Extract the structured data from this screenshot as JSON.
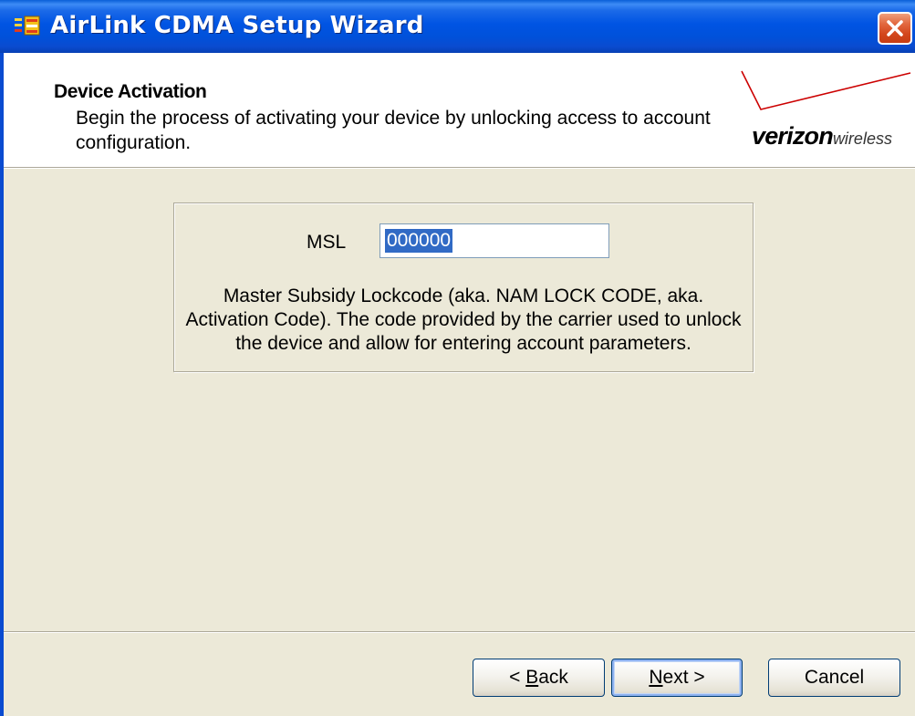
{
  "window": {
    "title": "AirLink CDMA Setup Wizard",
    "app_icon": "wizard-app-icon",
    "close_icon": "close-icon"
  },
  "header": {
    "title": "Device Activation",
    "description": "Begin the process of activating your device by unlocking access to account configuration.",
    "logo": {
      "brand": "verizon",
      "suffix": "wireless",
      "accent_color": "#cc0000"
    }
  },
  "msl": {
    "label": "MSL",
    "value": "000000",
    "help_text": "Master Subsidy Lockcode (aka. NAM LOCK CODE, aka. Activation Code). The code provided by the carrier used to unlock the device and allow for entering account parameters."
  },
  "buttons": {
    "back_prefix": "< ",
    "back_mnemonic": "B",
    "back_rest": "ack",
    "next_mnemonic": "N",
    "next_rest": "ext >",
    "cancel": "Cancel"
  },
  "colors": {
    "titlebar": "#0054e3",
    "selection": "#316ac5",
    "dialog_bg": "#ece9d8"
  }
}
